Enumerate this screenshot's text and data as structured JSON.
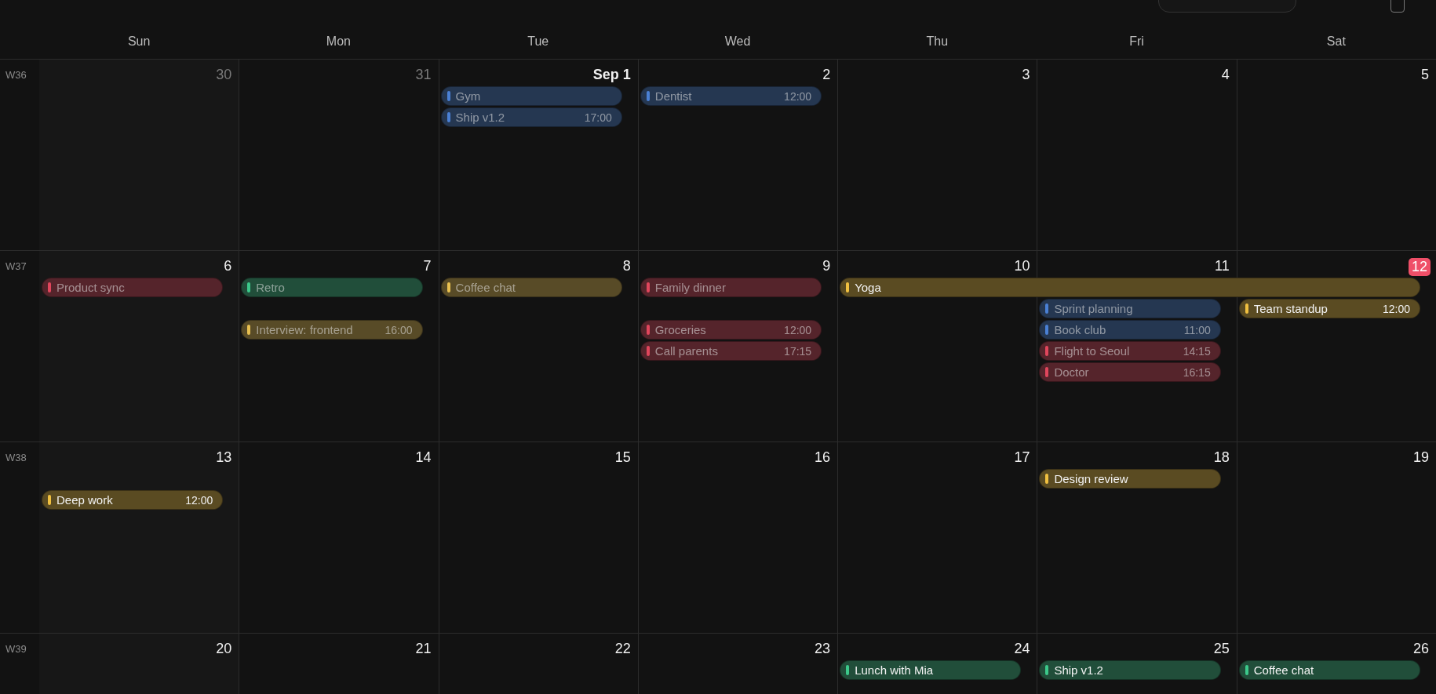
{
  "weekdays": [
    "Sun",
    "Mon",
    "Tue",
    "Wed",
    "Thu",
    "Fri",
    "Sat"
  ],
  "weeks": [
    {
      "label": "W36",
      "days": [
        {
          "number": "30",
          "in_month": false,
          "today": false
        },
        {
          "number": "31",
          "in_month": false,
          "today": false
        },
        {
          "number": "Sep 1",
          "in_month": true,
          "today": false,
          "events": [
            {
              "kind": "event",
              "title": "Gym",
              "color": "#4a80d4",
              "dimmed": true
            },
            {
              "kind": "event",
              "title": "Ship v1.2",
              "time": "17:00",
              "color": "#4a80d4",
              "dimmed": true
            }
          ]
        },
        {
          "number": "2",
          "in_month": true,
          "today": false,
          "events": [
            {
              "kind": "event",
              "title": "Dentist",
              "time": "12:00",
              "color": "#4a80d4",
              "dimmed": true
            }
          ]
        },
        {
          "number": "3",
          "in_month": true,
          "today": false
        },
        {
          "number": "4",
          "in_month": true,
          "today": false
        },
        {
          "number": "5",
          "in_month": true,
          "today": false
        }
      ]
    },
    {
      "label": "W37",
      "days": [
        {
          "number": "6",
          "in_month": true,
          "today": false,
          "events": [
            {
              "kind": "event",
              "title": "Product sync",
              "color": "#e0465c",
              "dimmed": true
            }
          ]
        },
        {
          "number": "7",
          "in_month": true,
          "today": false,
          "events": [
            {
              "kind": "event",
              "title": "Retro",
              "color": "#3cc88a",
              "dimmed": true
            },
            {
              "kind": "gap"
            },
            {
              "kind": "event",
              "title": "Interview: frontend",
              "time": "16:00",
              "color": "#e8c050",
              "dimmed": true
            }
          ]
        },
        {
          "number": "8",
          "in_month": true,
          "today": false,
          "events": [
            {
              "kind": "event",
              "title": "Coffee chat",
              "color": "#e8c050",
              "dimmed": true
            }
          ]
        },
        {
          "number": "9",
          "in_month": true,
          "today": false,
          "events": [
            {
              "kind": "event",
              "title": "Family dinner",
              "color": "#e0465c",
              "dimmed": true
            },
            {
              "kind": "gap"
            },
            {
              "kind": "event",
              "title": "Groceries",
              "time": "12:00",
              "color": "#e0465c",
              "dimmed": true
            },
            {
              "kind": "event",
              "title": "Call parents",
              "time": "17:15",
              "color": "#e0465c",
              "dimmed": true
            }
          ]
        },
        {
          "number": "10",
          "in_month": true,
          "today": false,
          "events": [
            {
              "kind": "multi_day",
              "title": "Yoga",
              "color": "#f0c040",
              "dimmed": false
            }
          ]
        },
        {
          "number": "11",
          "in_month": true,
          "today": false,
          "events": [
            {
              "kind": "gap"
            },
            {
              "kind": "event",
              "title": "Sprint planning",
              "color": "#4a80d4",
              "dimmed": true
            },
            {
              "kind": "event",
              "title": "Book club",
              "time": "11:00",
              "color": "#4a80d4",
              "dimmed": true
            },
            {
              "kind": "event",
              "title": "Flight to Seoul",
              "time": "14:15",
              "color": "#e0465c",
              "dimmed": true
            },
            {
              "kind": "event",
              "title": "Doctor",
              "time": "16:15",
              "color": "#e0465c",
              "dimmed": true
            }
          ]
        },
        {
          "number": "12",
          "in_month": true,
          "today": true,
          "events": [
            {
              "kind": "gap"
            },
            {
              "kind": "event",
              "title": "Team standup",
              "time": "12:00",
              "color": "#f0c040",
              "dimmed": false
            }
          ]
        }
      ]
    },
    {
      "label": "W38",
      "days": [
        {
          "number": "13",
          "in_month": true,
          "today": false,
          "events": [
            {
              "kind": "gap"
            },
            {
              "kind": "event",
              "title": "Deep work",
              "time": "12:00",
              "color": "#f0c040",
              "dimmed": false
            }
          ]
        },
        {
          "number": "14",
          "in_month": true,
          "today": false
        },
        {
          "number": "15",
          "in_month": true,
          "today": false
        },
        {
          "number": "16",
          "in_month": true,
          "today": false
        },
        {
          "number": "17",
          "in_month": true,
          "today": false
        },
        {
          "number": "18",
          "in_month": true,
          "today": false,
          "events": [
            {
              "kind": "event",
              "title": "Design review",
              "color": "#f0c040",
              "dimmed": false
            }
          ]
        },
        {
          "number": "19",
          "in_month": true,
          "today": false
        }
      ]
    },
    {
      "label": "W39",
      "days": [
        {
          "number": "20",
          "in_month": true,
          "today": false
        },
        {
          "number": "21",
          "in_month": true,
          "today": false
        },
        {
          "number": "22",
          "in_month": true,
          "today": false
        },
        {
          "number": "23",
          "in_month": true,
          "today": false
        },
        {
          "number": "24",
          "in_month": true,
          "today": false,
          "events": [
            {
              "kind": "event",
              "title": "Lunch with Mia",
              "color": "#3cc88a",
              "dimmed": false
            }
          ]
        },
        {
          "number": "25",
          "in_month": true,
          "today": false,
          "events": [
            {
              "kind": "event",
              "title": "Ship v1.2",
              "color": "#3cc88a",
              "dimmed": false
            }
          ]
        },
        {
          "number": "26",
          "in_month": true,
          "today": false,
          "events": [
            {
              "kind": "event",
              "title": "Coffee chat",
              "color": "#3cc88a",
              "dimmed": false
            }
          ]
        }
      ]
    }
  ]
}
